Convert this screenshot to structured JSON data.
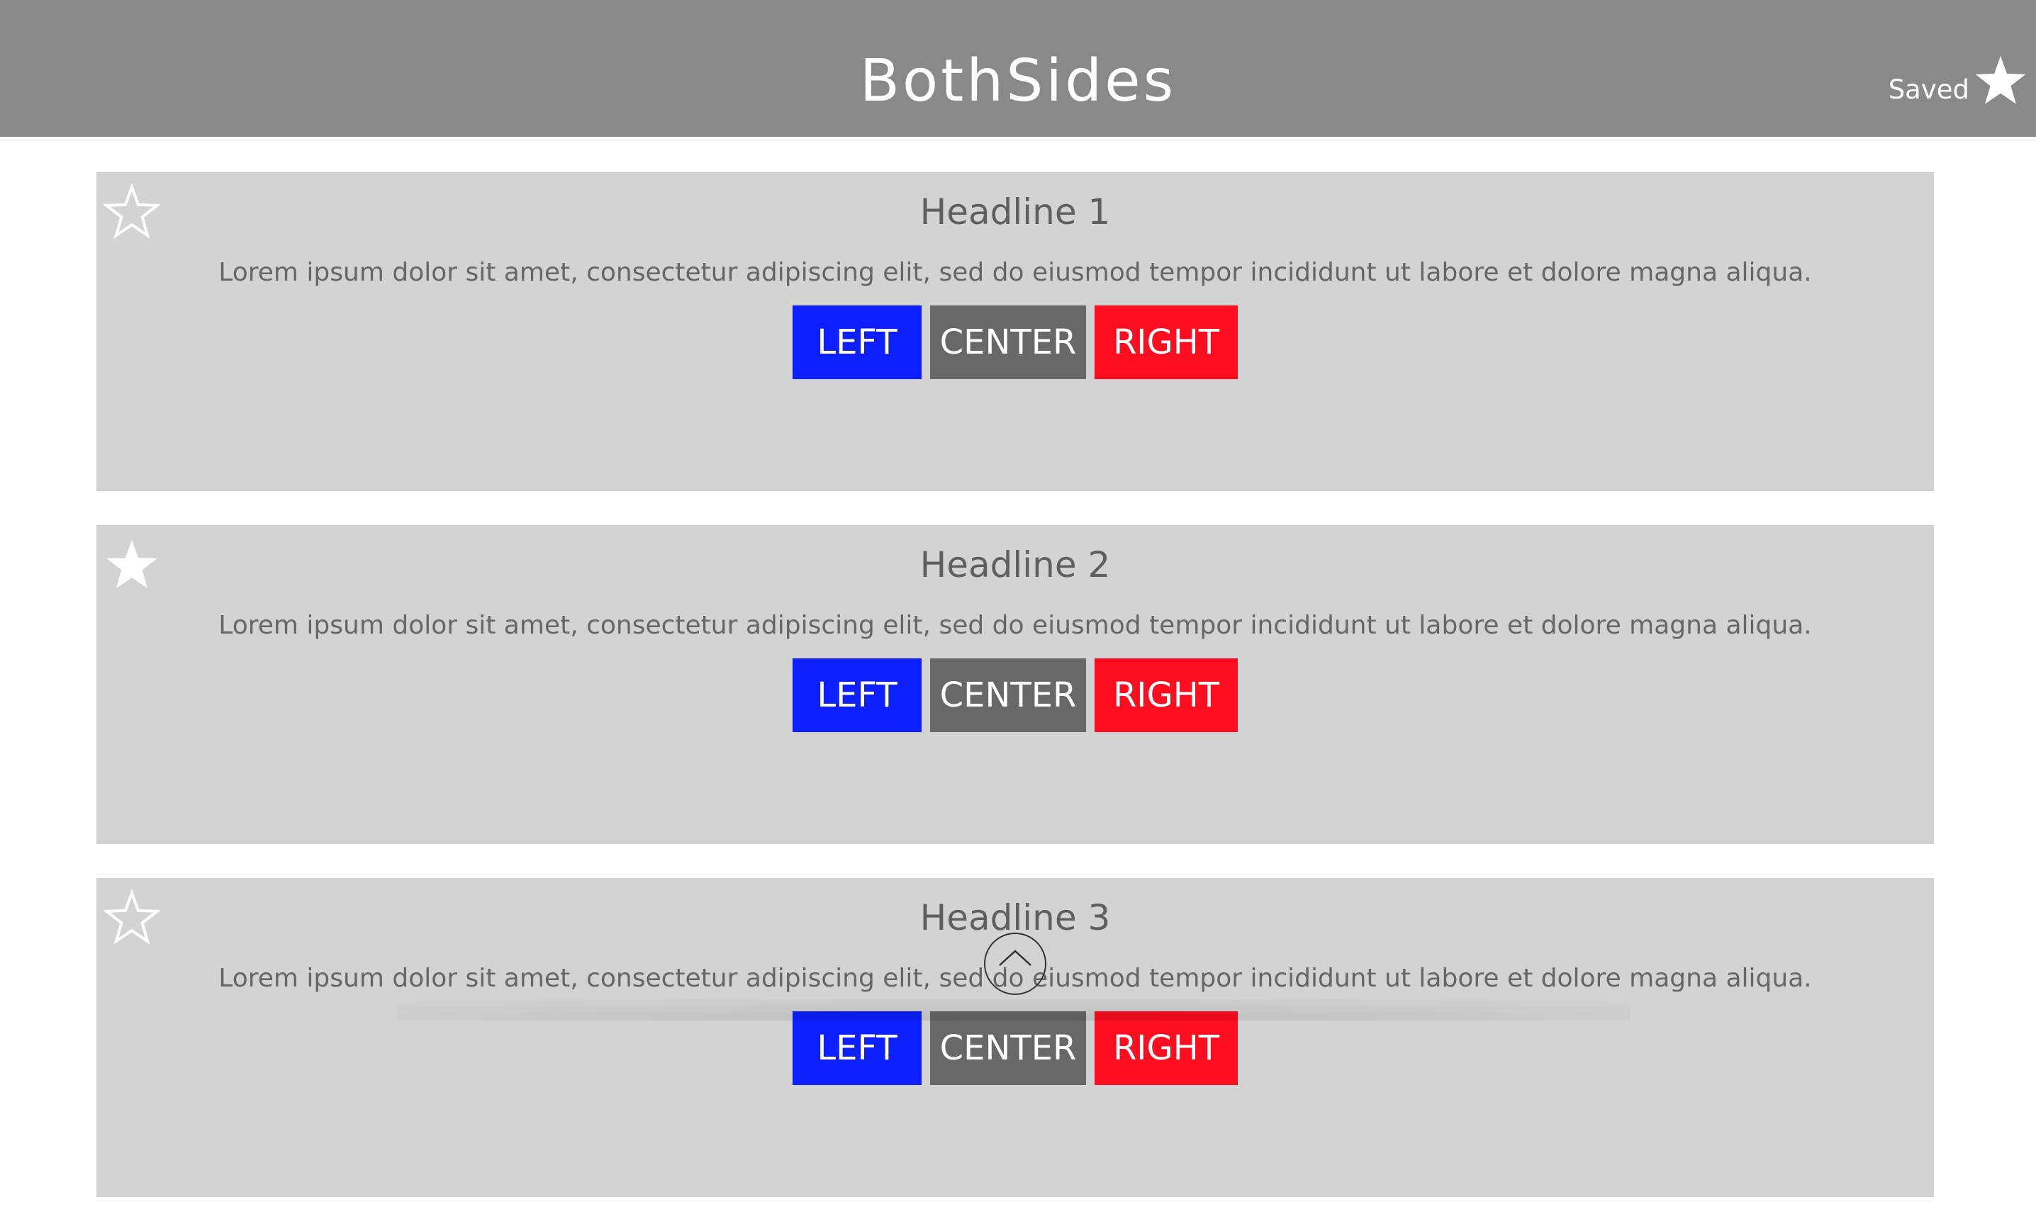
{
  "header": {
    "title": "BothSides",
    "saved_label": "Saved"
  },
  "colors": {
    "header_bg": "#898989",
    "card_bg": "#d3d3d3",
    "left": "#0d1ffc",
    "center": "#686868",
    "right": "#fc0d1f"
  },
  "icons": {
    "saved": "star-filled-icon",
    "scroll_top": "chevron-up-icon"
  },
  "articles": [
    {
      "headline": "Headline 1",
      "summary": "Lorem ipsum dolor sit amet, consectetur adipiscing elit, sed do eiusmod tempor incididunt ut labore et dolore magna aliqua.",
      "saved": false,
      "buttons": {
        "left": "LEFT",
        "center": "CENTER",
        "right": "RIGHT"
      }
    },
    {
      "headline": "Headline 2",
      "summary": "Lorem ipsum dolor sit amet, consectetur adipiscing elit, sed do eiusmod tempor incididunt ut labore et dolore magna aliqua.",
      "saved": true,
      "buttons": {
        "left": "LEFT",
        "center": "CENTER",
        "right": "RIGHT"
      }
    },
    {
      "headline": "Headline 3",
      "summary": "Lorem ipsum dolor sit amet, consectetur adipiscing elit, sed do eiusmod tempor incididunt ut labore et dolore magna aliqua.",
      "saved": false,
      "buttons": {
        "left": "LEFT",
        "center": "CENTER",
        "right": "RIGHT"
      }
    }
  ]
}
